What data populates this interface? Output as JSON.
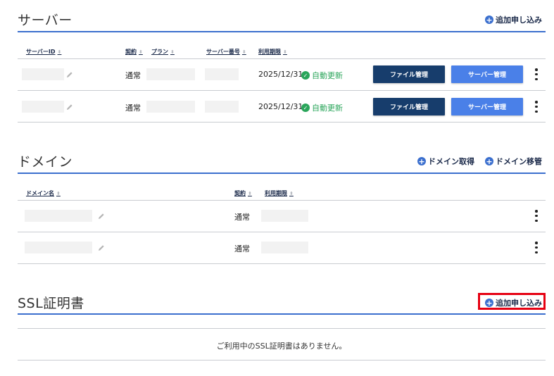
{
  "server": {
    "title": "サーバー",
    "add_label": "追加申し込み",
    "columns": [
      {
        "label": "サーバーID"
      },
      {
        "label": "契約"
      },
      {
        "label": "プラン"
      },
      {
        "label": "サーバー番号"
      },
      {
        "label": "利用期限"
      }
    ],
    "rows": [
      {
        "contract": "通常",
        "expiry": "2025/12/31",
        "renew_label": "自動更新",
        "file_btn": "ファイル管理",
        "server_btn": "サーバー管理"
      },
      {
        "contract": "通常",
        "expiry": "2025/12/31",
        "renew_label": "自動更新",
        "file_btn": "ファイル管理",
        "server_btn": "サーバー管理"
      }
    ]
  },
  "domain": {
    "title": "ドメイン",
    "acquire_label": "ドメイン取得",
    "transfer_label": "ドメイン移管",
    "columns": [
      {
        "label": "ドメイン名"
      },
      {
        "label": "契約"
      },
      {
        "label": "利用期限"
      }
    ],
    "rows": [
      {
        "contract": "通常"
      },
      {
        "contract": "通常"
      }
    ]
  },
  "ssl": {
    "title": "SSL証明書",
    "add_label": "追加申し込み",
    "empty_message": "ご利用中のSSL証明書はありません。"
  },
  "icons": {
    "plus": "plus-circle-icon",
    "sort": "sort-icon",
    "edit": "pencil-icon",
    "check": "check-circle-icon",
    "more": "kebab-icon"
  },
  "colors": {
    "accent_blue": "#3b6fce",
    "dark_button": "#173d6c",
    "light_button": "#4a80e8",
    "renew_green": "#2aa55a",
    "highlight_red": "#e60012"
  }
}
